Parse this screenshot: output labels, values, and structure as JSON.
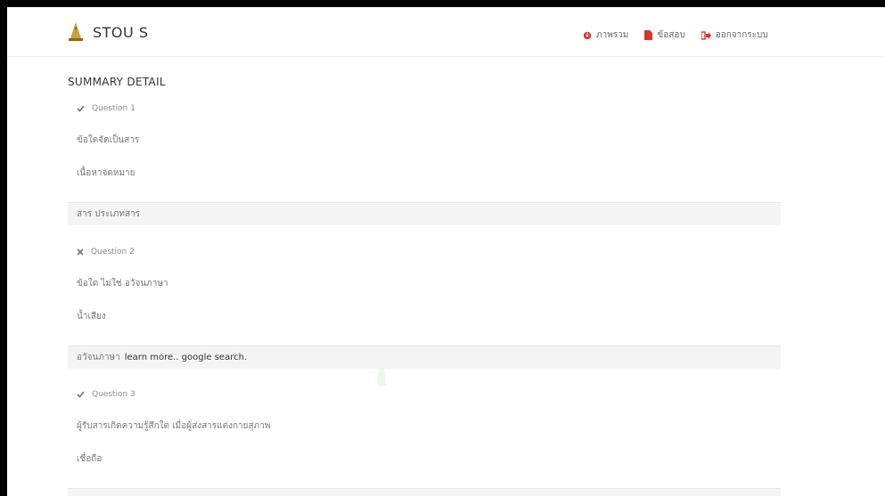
{
  "app": {
    "brand": "STOU S"
  },
  "nav": {
    "items": [
      {
        "label": "ภาพรวม",
        "icon": "dashboard-icon"
      },
      {
        "label": "ข้อสอบ",
        "icon": "file-icon"
      },
      {
        "label": "ออกจากระบบ",
        "icon": "sign-out-icon"
      }
    ]
  },
  "page": {
    "title": "SUMMARY DETAIL"
  },
  "questions": [
    {
      "title": "Question 1",
      "status": "correct",
      "question_text": "ข้อใดจัดเป็นสาร",
      "choice_text": "เนื้อหาจดหมาย",
      "answer_text": "สาร ประเภทสาร",
      "answer_links": ""
    },
    {
      "title": "Question 2",
      "status": "incorrect",
      "question_text": "ข้อใด ไม่ใช่ อวัจนภาษา",
      "choice_text": "น้ำเสียง",
      "answer_text": "อวัจนภาษา",
      "answer_links": "learn more.. google search."
    },
    {
      "title": "Question 3",
      "status": "correct",
      "question_text": "ผู้รับสารเกิดความรู้สึกใด เมื่อผู้ส่งสารแต่งกายสุภาพ",
      "choice_text": "เชื่อถือ",
      "answer_text": "",
      "answer_links": ""
    }
  ],
  "colors": {
    "accent": "#d9342b",
    "text": "#777777",
    "answer_bg": "#f4f4f4",
    "brand_gold": "#c8a03a"
  }
}
